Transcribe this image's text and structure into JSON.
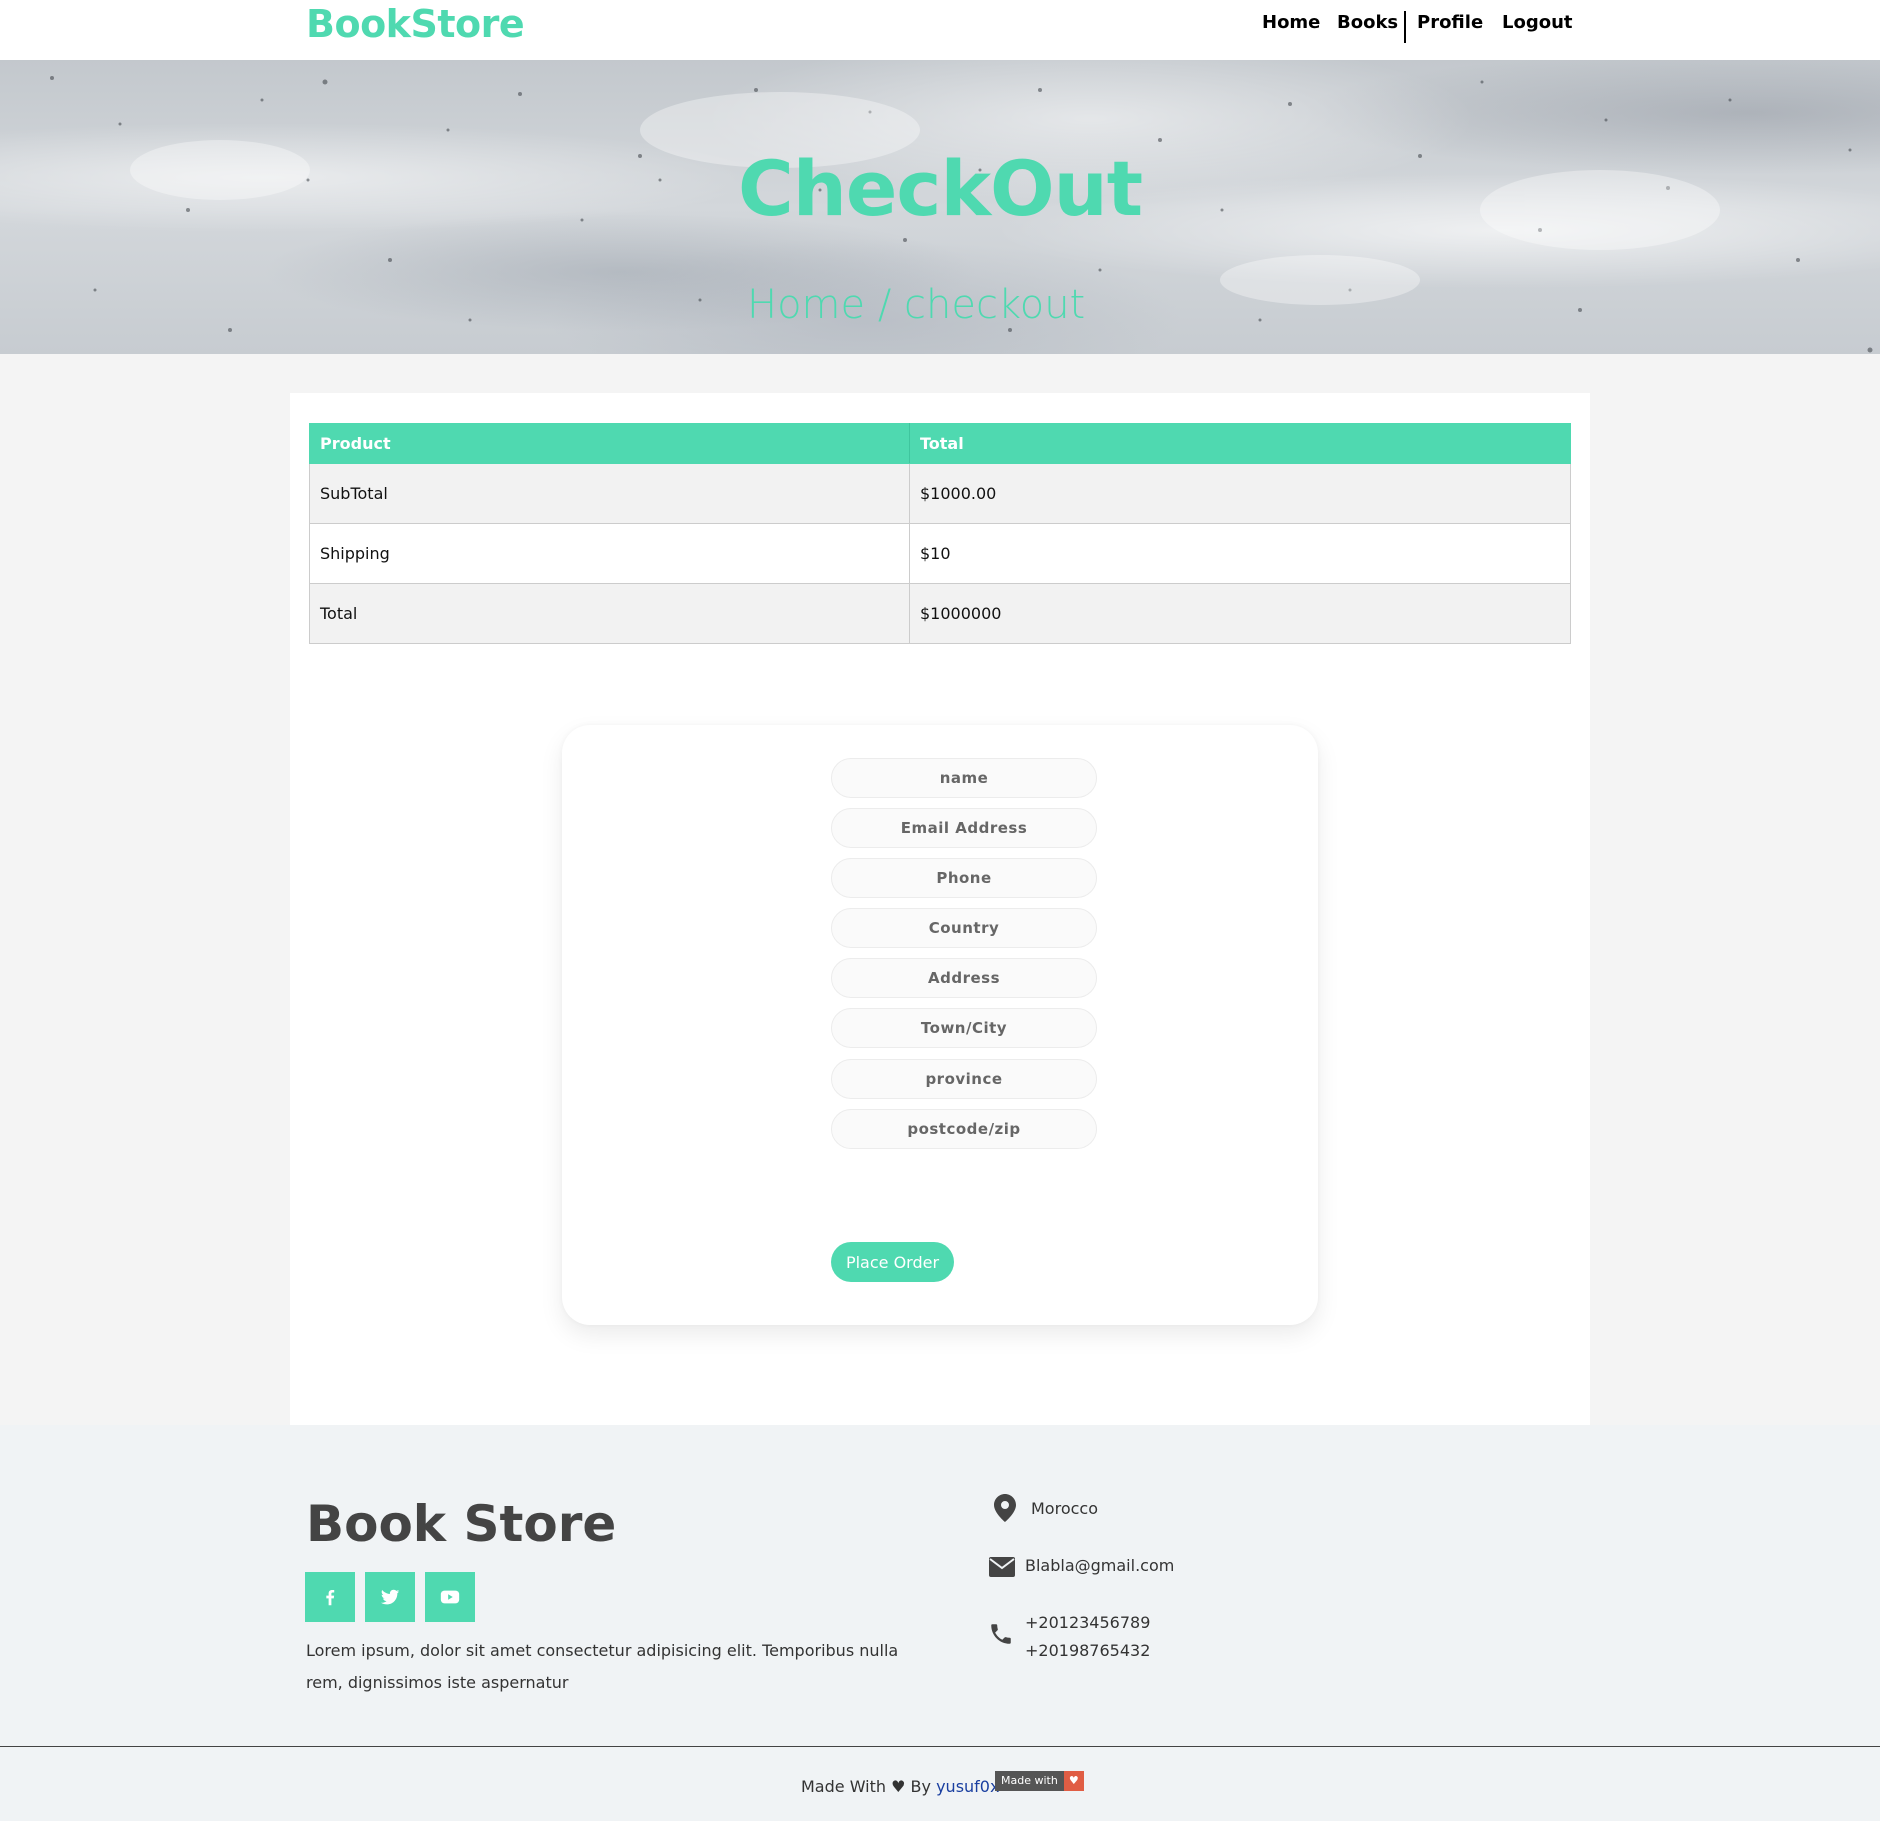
{
  "navbar": {
    "brand": "BookStore",
    "links": {
      "home": "Home",
      "books": "Books",
      "profile": "Profile",
      "logout": "Logout"
    }
  },
  "hero": {
    "title": "CheckOut",
    "breadcrumb": "Home / checkout"
  },
  "summary_table": {
    "headers": [
      "Product",
      "Total"
    ],
    "rows": [
      [
        "SubTotal",
        "$1000.00"
      ],
      [
        "Shipping",
        "$10"
      ],
      [
        "Total",
        "$1000000"
      ]
    ]
  },
  "checkout_form": {
    "name_placeholder": "name",
    "email_placeholder": "Email Address",
    "phone_placeholder": "Phone",
    "country_placeholder": "Country",
    "address_placeholder": "Address",
    "city_placeholder": "Town/City",
    "province_placeholder": "province",
    "postcode_placeholder": "postcode/zip",
    "submit_label": "Place Order"
  },
  "footer": {
    "brand": "Book Store",
    "description": "Lorem ipsum, dolor sit amet consectetur adipisicing elit. Temporibus nulla rem, dignissimos iste aspernatur",
    "social_icons": [
      "facebook-icon",
      "twitter-icon",
      "youtube-icon"
    ],
    "location": "Morocco",
    "email": "Blabla@gmail.com",
    "phone_1": "+20123456789",
    "phone_2": "+20198765432",
    "credit_prefix": "Made With ♥ By",
    "credit_author": "yusuf0x",
    "badge_left": "Made with",
    "badge_right": "♥"
  },
  "colors": {
    "accent": "#4fd9b0",
    "text_dark": "#444444",
    "footer_bg": "#f0f3f5"
  }
}
